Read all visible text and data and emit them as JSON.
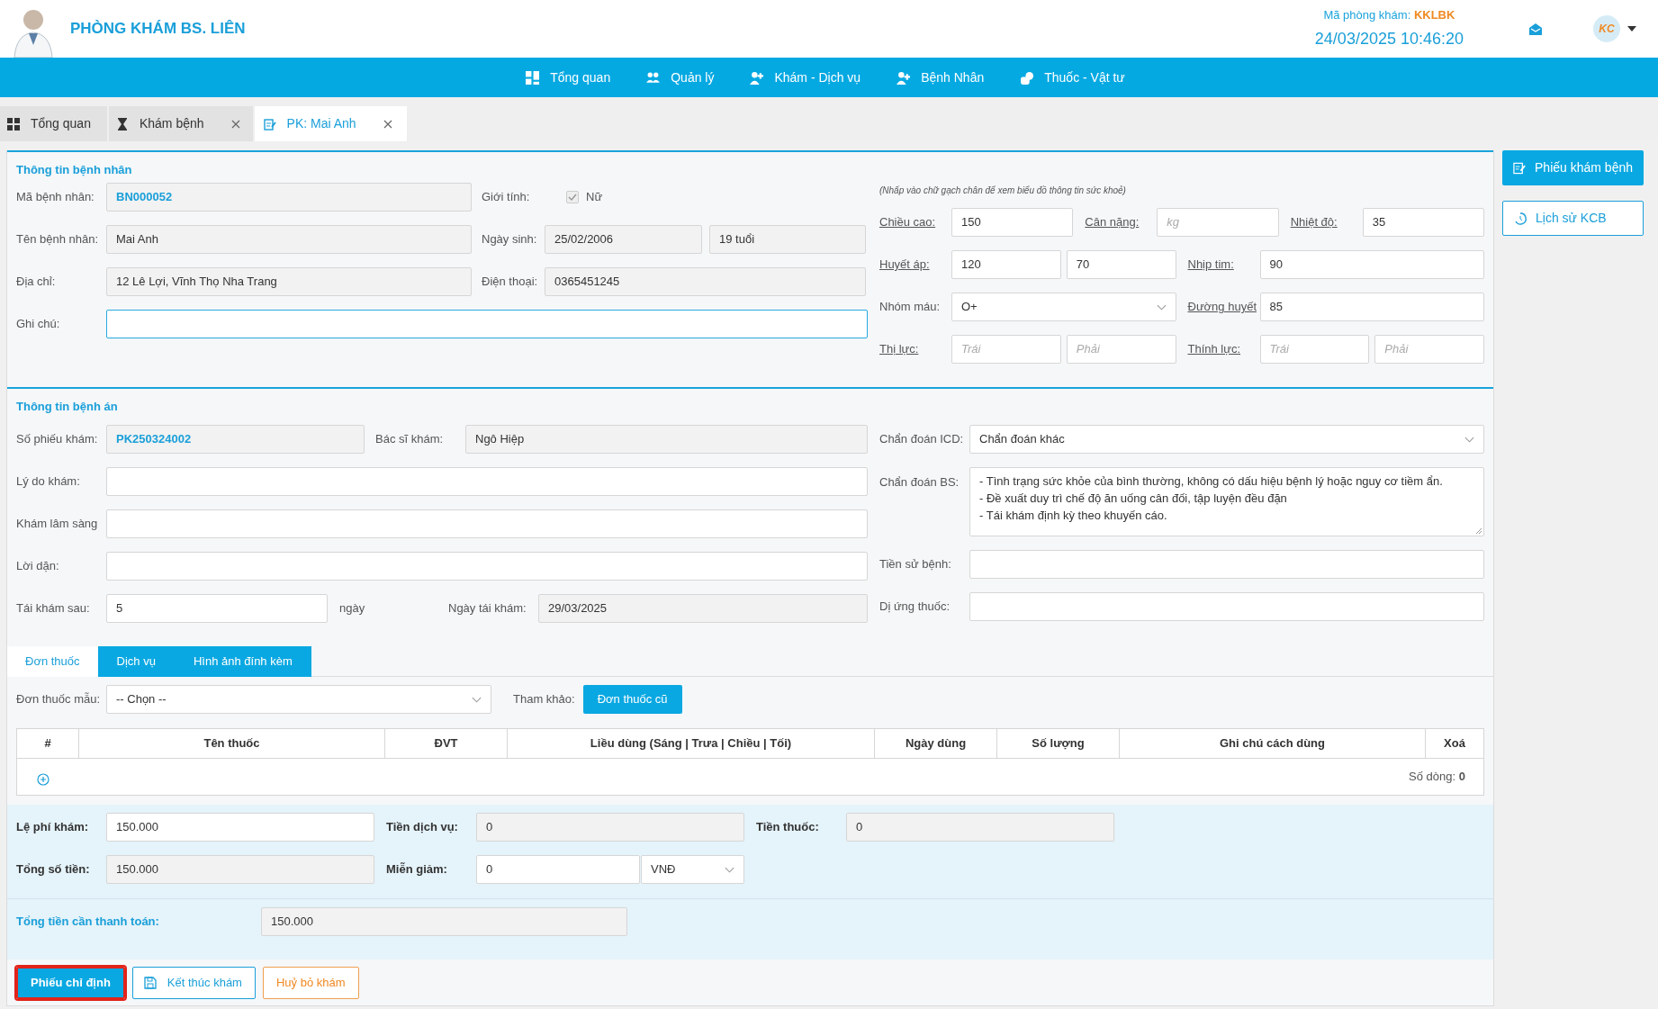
{
  "header": {
    "clinic_name": "PHÒNG KHÁM BS. LIÊN",
    "room_label": "Mã phòng khám:",
    "room_code": "KKLBK",
    "datetime": "24/03/2025 10:46:20",
    "user_initials": "KC"
  },
  "nav": [
    {
      "label": "Tổng quan"
    },
    {
      "label": "Quản lý"
    },
    {
      "label": "Khám - Dịch vụ"
    },
    {
      "label": "Bệnh Nhân"
    },
    {
      "label": "Thuốc - Vật tư"
    }
  ],
  "tabs": [
    {
      "label": "Tổng quan",
      "selected": false,
      "closable": false
    },
    {
      "label": "Khám bệnh",
      "selected": false,
      "closable": true
    },
    {
      "label": "PK: Mai Anh",
      "selected": true,
      "closable": true
    }
  ],
  "patient": {
    "title": "Thông tin bệnh nhân",
    "patient_id": {
      "label": "Mã bệnh nhân:",
      "value": "BN000052",
      "readonly": true,
      "kind": "code"
    },
    "gender": {
      "label": "Giới tính:",
      "option": "Nữ",
      "checked": true
    },
    "name": {
      "label": "Tên bệnh nhân:",
      "value": "Mai Anh",
      "readonly": true
    },
    "birth_date": {
      "label": "Ngày sinh:",
      "value": "25/02/2006",
      "readonly": true
    },
    "age": {
      "value": "19 tuổi",
      "readonly": true
    },
    "address": {
      "label": "Địa chỉ:",
      "value": "12 Lê Lợi, Vĩnh Thọ Nha Trang",
      "readonly": true
    },
    "phone": {
      "label": "Điện thoại:",
      "value": "0365451245",
      "readonly": true
    },
    "note": {
      "label": "Ghi chú:",
      "readonly": false,
      "focused": true
    }
  },
  "vitals": {
    "hint": "(Nhấp vào chữ gạch chân để xem biểu đồ thông tin sức khoẻ)",
    "rows": [
      {
        "fields": [
          {
            "label": "Chiều cao:",
            "underlined": true,
            "inputs": [
              {
                "value": "150"
              }
            ]
          },
          {
            "label": "Cân nặng:",
            "underlined": true,
            "inputs": [
              {
                "placeholder": "kg"
              }
            ]
          },
          {
            "label": "Nhiệt độ:",
            "underlined": true,
            "inputs": [
              {
                "value": "35"
              }
            ]
          }
        ]
      },
      {
        "fields": [
          {
            "label": "Huyết áp:",
            "underlined": true,
            "inputs": [
              {
                "value": "120"
              },
              {
                "value": "70"
              }
            ]
          },
          {
            "label": "Nhịp tim:",
            "underlined": true,
            "inputs": [
              {
                "value": "90"
              }
            ]
          }
        ]
      },
      {
        "fields": [
          {
            "label": "Nhóm máu:",
            "underlined": false,
            "inputs": [
              {
                "value": "O+",
                "kind": "select"
              }
            ]
          },
          {
            "label": "Đường huyết",
            "underlined": true,
            "inputs": [
              {
                "value": "85"
              }
            ]
          }
        ]
      },
      {
        "fields": [
          {
            "label": "Thị lực:",
            "underlined": true,
            "inputs": [
              {
                "placeholder": "Trái"
              },
              {
                "placeholder": "Phải"
              }
            ]
          },
          {
            "label": "Thính lực:",
            "underlined": true,
            "inputs": [
              {
                "placeholder": "Trái"
              },
              {
                "placeholder": "Phải"
              }
            ]
          }
        ]
      }
    ]
  },
  "record": {
    "title": "Thông tin bệnh án",
    "exam_no": {
      "label": "Số phiếu khám:",
      "value": "PK250324002",
      "readonly": true,
      "kind": "code"
    },
    "doctor": {
      "label": "Bác sĩ khám:",
      "value": "Ngô Hiệp",
      "readonly": true
    },
    "reason": {
      "label": "Lý do khám:",
      "readonly": false
    },
    "clinical": {
      "label": "Khám lâm sàng",
      "readonly": false
    },
    "advice": {
      "label": "Lời dặn:",
      "readonly": false
    },
    "revisit_after": {
      "label": "Tái khám sau:",
      "value": "5",
      "readonly": false,
      "unit": "ngày"
    },
    "revisit_date": {
      "label": "Ngày tái khám:",
      "value": "29/03/2025",
      "readonly": true
    },
    "icd": {
      "label": "Chẩn đoán ICD:",
      "value": "Chẩn đoán khác",
      "kind": "select",
      "readonly": false
    },
    "diagnosis": {
      "label": "Chẩn đoán BS:",
      "lines": [
        "- Tình trạng sức khỏe của bình thường, không có dấu hiệu bệnh lý hoặc nguy cơ tiềm ẩn.",
        "- Đề xuất duy trì chế độ ăn uống cân đối, tập luyện đều đặn",
        "- Tái khám định kỳ theo khuyến cáo."
      ]
    },
    "history": {
      "label": "Tiền sử bệnh:",
      "readonly": false
    },
    "allergy": {
      "label": "Dị ứng thuốc:",
      "readonly": false
    }
  },
  "sub_tabs": [
    {
      "label": "Đơn thuốc",
      "selected": true
    },
    {
      "label": "Dịch vụ",
      "selected": false
    },
    {
      "label": "Hình ảnh đính kèm",
      "selected": false
    }
  ],
  "prescription": {
    "template": {
      "label": "Đơn thuốc mẫu:",
      "value": "-- Chọn --",
      "kind": "select",
      "readonly": false
    },
    "reference_label": "Tham khảo:",
    "reference_button": "Đơn thuốc cũ",
    "table": {
      "columns": [
        "#",
        "Tên thuốc",
        "ĐVT",
        "Liều dùng (Sáng | Trưa | Chiều | Tối)",
        "Ngày dùng",
        "Số lượng",
        "Ghi chú cách dùng",
        "Xoá"
      ],
      "row_count": "Số dòng: **0**"
    }
  },
  "fees": {
    "exam_fee": {
      "label": "Lệ phí khám:",
      "value": "150.000",
      "readonly": false
    },
    "service_fee": {
      "label": "Tiền dịch vụ:",
      "value": "0",
      "readonly": true
    },
    "drug_fee": {
      "label": "Tiền thuốc:",
      "value": "0",
      "readonly": true
    },
    "total": {
      "label": "Tổng số tiền:",
      "value": "150.000",
      "readonly": true
    },
    "discount": {
      "label": "Miễn giảm:",
      "value": "0",
      "readonly": false
    },
    "currency": {
      "value": "VNĐ",
      "kind": "select",
      "readonly": false
    },
    "payable": {
      "label": "Tổng tiền cần thanh toán:",
      "value": "150.000",
      "readonly": true
    }
  },
  "actions": [
    {
      "label": "Phiếu chỉ định",
      "kind": "primary",
      "highlighted": true
    },
    {
      "label": "Kết thúc khám",
      "kind": "outline",
      "highlighted": false
    },
    {
      "label": "Huỷ bỏ khám",
      "kind": "warning",
      "highlighted": false
    }
  ],
  "side_actions": [
    {
      "label": "Phiếu khám bệnh",
      "kind": "primary"
    },
    {
      "label": "Lịch sử KCB",
      "kind": "outline"
    }
  ]
}
